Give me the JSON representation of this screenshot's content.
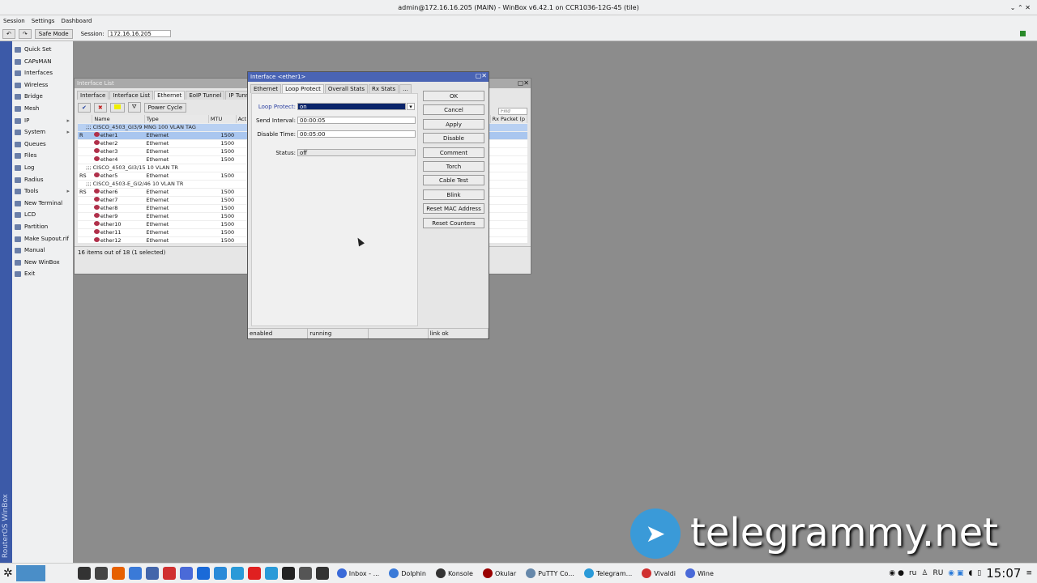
{
  "window_title": "admin@172.16.16.205 (MAIN) - WinBox v6.42.1 on CCR1036-12G-45 (tile)",
  "menu": [
    "Session",
    "Settings",
    "Dashboard"
  ],
  "toolbar": {
    "safe_mode": "Safe Mode",
    "session_label": "Session:",
    "session_value": "172.16.16.205"
  },
  "vertical_label": "RouterOS WinBox",
  "sidebar": [
    {
      "label": "Quick Set"
    },
    {
      "label": "CAPsMAN"
    },
    {
      "label": "Interfaces"
    },
    {
      "label": "Wireless"
    },
    {
      "label": "Bridge"
    },
    {
      "label": "Mesh"
    },
    {
      "label": "IP",
      "sub": "▸"
    },
    {
      "label": "System",
      "sub": "▸"
    },
    {
      "label": "Queues"
    },
    {
      "label": "Files"
    },
    {
      "label": "Log"
    },
    {
      "label": "Radius"
    },
    {
      "label": "Tools",
      "sub": "▸"
    },
    {
      "label": "New Terminal"
    },
    {
      "label": "LCD"
    },
    {
      "label": "Partition"
    },
    {
      "label": "Make Supout.rif"
    },
    {
      "label": "Manual"
    },
    {
      "label": "New WinBox"
    },
    {
      "label": "Exit"
    }
  ],
  "iface_list": {
    "title": "Interface List",
    "tabs": [
      "Interface",
      "Interface List",
      "Ethernet",
      "EoIP Tunnel",
      "IP Tunnel"
    ],
    "power_cycle": "Power Cycle",
    "find_placeholder": "Find",
    "columns": [
      "",
      "Name",
      "Type",
      "MTU",
      "Act",
      "Rx Packet (p"
    ],
    "rows": [
      {
        "comment": ";;; CISCO_4503_GI3/9 MNG 100 VLAN TAG",
        "hl": true
      },
      {
        "flag": "R",
        "name": "ether1",
        "type": "Ethernet",
        "mtu": "1500",
        "sel": true
      },
      {
        "flag": "",
        "name": "ether2",
        "type": "Ethernet",
        "mtu": "1500"
      },
      {
        "flag": "",
        "name": "ether3",
        "type": "Ethernet",
        "mtu": "1500"
      },
      {
        "flag": "",
        "name": "ether4",
        "type": "Ethernet",
        "mtu": "1500"
      },
      {
        "comment": ";;; CISCO_4503_GI3/15 10  VLAN TR"
      },
      {
        "flag": "RS",
        "name": "ether5",
        "type": "Ethernet",
        "mtu": "1500"
      },
      {
        "comment": ";;; CISCO_4503-E_GI2/46 10 VLAN TR"
      },
      {
        "flag": "RS",
        "name": "ether6",
        "type": "Ethernet",
        "mtu": "1500"
      },
      {
        "flag": "",
        "name": "ether7",
        "type": "Ethernet",
        "mtu": "1500"
      },
      {
        "flag": "",
        "name": "ether8",
        "type": "Ethernet",
        "mtu": "1500"
      },
      {
        "flag": "",
        "name": "ether9",
        "type": "Ethernet",
        "mtu": "1500"
      },
      {
        "flag": "",
        "name": "ether10",
        "type": "Ethernet",
        "mtu": "1500"
      },
      {
        "flag": "",
        "name": "ether11",
        "type": "Ethernet",
        "mtu": "1500"
      },
      {
        "flag": "",
        "name": "ether12",
        "type": "Ethernet",
        "mtu": "1500"
      }
    ],
    "status": "16 items out of 18 (1 selected)"
  },
  "dialog": {
    "title": "Interface <ether1>",
    "tabs": [
      "Ethernet",
      "Loop Protect",
      "Overall Stats",
      "Rx Stats",
      "..."
    ],
    "loop_protect_label": "Loop Protect:",
    "loop_protect_value": "on",
    "send_interval_label": "Send Interval:",
    "send_interval_value": "00:00:05",
    "disable_time_label": "Disable Time:",
    "disable_time_value": "00:05:00",
    "status_label": "Status:",
    "status_value": "off",
    "buttons": [
      "OK",
      "Cancel",
      "Apply",
      "Disable",
      "Comment",
      "Torch",
      "Cable Test",
      "Blink",
      "Reset MAC Address",
      "Reset Counters"
    ],
    "statusbar": [
      "enabled",
      "running",
      "",
      "link ok"
    ]
  },
  "watermark": "telegrammy.net",
  "taskbar": {
    "tasks": [
      "Inbox - ...",
      "Dolphin",
      "Konsole",
      "Okular",
      "PuTTY Co...",
      "Telegram...",
      "Vivaldi",
      "Wine"
    ],
    "lang": "ru",
    "kbd": "RU",
    "clock": "15:07"
  },
  "colors": {
    "title_blue": "#4a64b4",
    "selection": "#a9c6ef",
    "combo_sel": "#0a246a"
  }
}
